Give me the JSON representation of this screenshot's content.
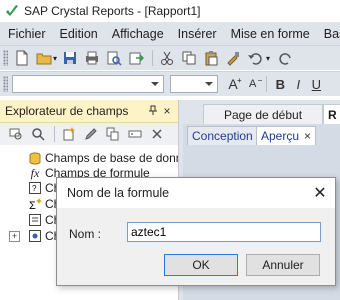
{
  "window": {
    "title": "SAP Crystal Reports - [Rapport1]"
  },
  "menu": [
    "Fichier",
    "Edition",
    "Affichage",
    "Insérer",
    "Mise en forme",
    "Base"
  ],
  "format_toolbar": {
    "font_value": "",
    "size_value": "",
    "grow_font": "A",
    "shrink_font": "A",
    "bold": "B",
    "italic": "I",
    "underline": "U"
  },
  "field_explorer": {
    "title": "Explorateur de champs",
    "pin": "ₕ",
    "close": "×",
    "items": [
      {
        "label": "Champs de base de données",
        "icon": "database-icon",
        "expandable": false
      },
      {
        "label": "Champs de formule",
        "icon": "formula-icon",
        "expandable": false
      },
      {
        "label": "Ch",
        "icon": "parameter-icon",
        "expandable": false
      },
      {
        "label": "Ch",
        "icon": "running-total-icon",
        "expandable": false
      },
      {
        "label": "Ch",
        "icon": "group-name-icon",
        "expandable": false
      },
      {
        "label": "Ch",
        "icon": "special-fields-icon",
        "expandable": true
      }
    ]
  },
  "document_tabs": {
    "start_page": "Page de début",
    "report_tab": "R"
  },
  "view_tabs": {
    "conception": "Conception",
    "apercu": "Aperçu",
    "close": "×"
  },
  "dialog": {
    "title": "Nom de la formule",
    "close": "✕",
    "label": "Nom :",
    "input_value": "aztec1",
    "ok": "OK",
    "cancel": "Annuler"
  },
  "colors": {
    "menubar": "#dfe3ea",
    "panel_title": "#fef3c7",
    "accent_blue": "#2b7be0"
  }
}
